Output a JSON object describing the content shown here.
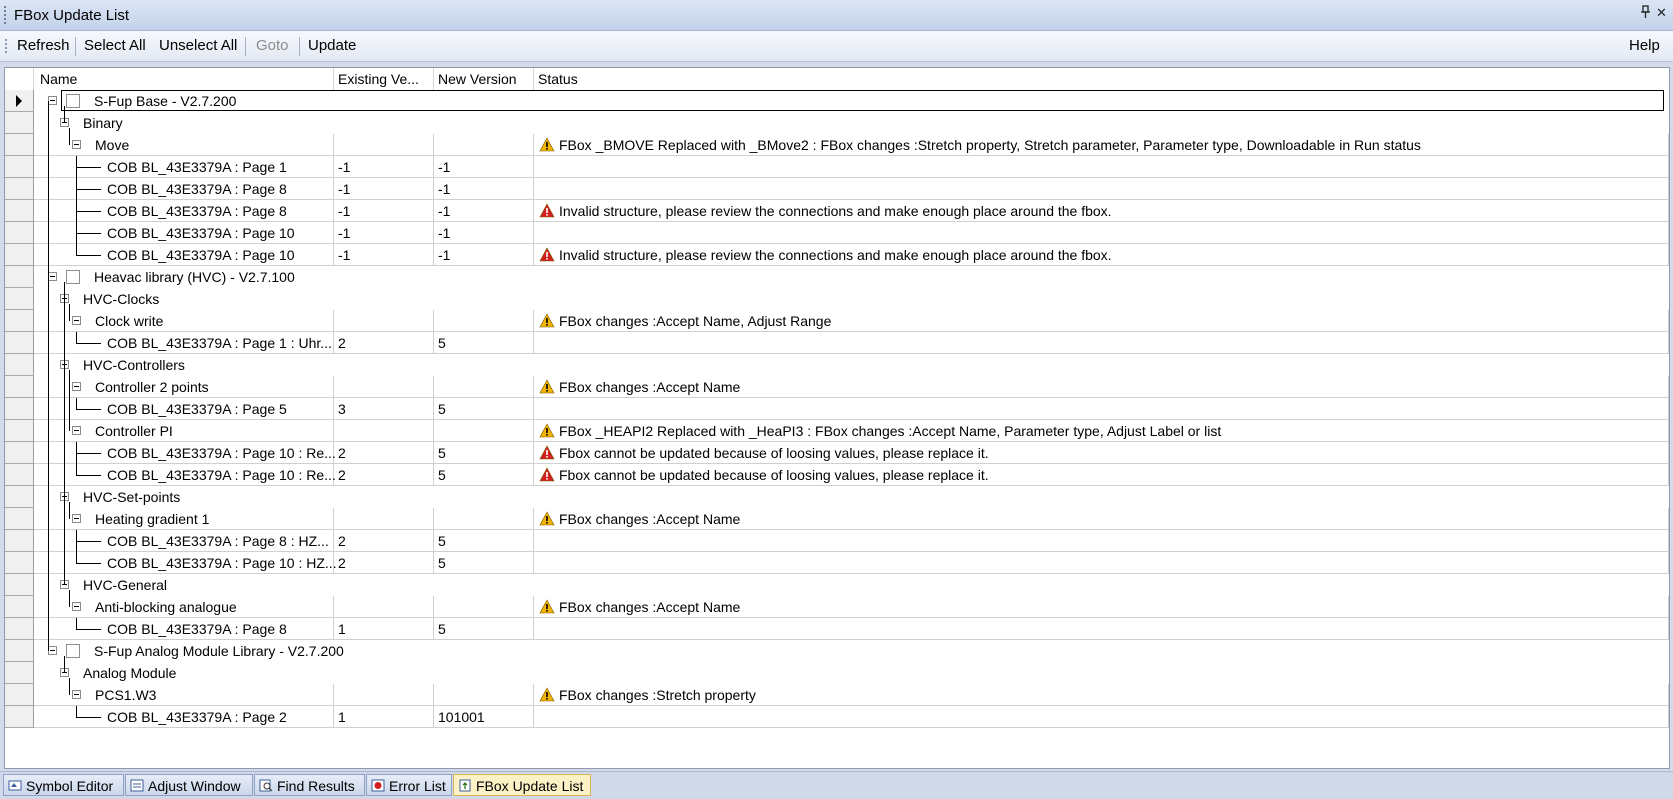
{
  "window": {
    "title": "FBox Update List",
    "pin_glyph": "ᵖ",
    "close_glyph": "✕"
  },
  "toolbar": {
    "refresh": "Refresh",
    "select_all": "Select All",
    "unselect_all": "Unselect All",
    "goto": "Goto",
    "update": "Update",
    "help": "Help"
  },
  "grid": {
    "columns": {
      "name": "Name",
      "existing": "Existing Ve...",
      "new": "New Version",
      "status": "Status"
    },
    "rows": [
      {
        "level": 0,
        "name": "S-Fup Base - V2.7.200",
        "existing": "",
        "new": "",
        "status": "",
        "icon": "",
        "checkbox": true,
        "expander": true,
        "current": true
      },
      {
        "level": 1,
        "name": "Binary",
        "existing": "",
        "new": "",
        "status": "",
        "icon": "",
        "expander": true
      },
      {
        "level": 2,
        "name": "Move",
        "existing": "",
        "new": "",
        "status": "FBox _BMOVE Replaced with _BMove2 : FBox changes :Stretch property, Stretch parameter, Parameter type, Downloadable in Run status",
        "icon": "warning",
        "expander": true,
        "cells": true
      },
      {
        "level": 3,
        "name": "COB BL_43E3379A : Page 1",
        "existing": "-1",
        "new": "-1",
        "status": "",
        "icon": "",
        "cells": true
      },
      {
        "level": 3,
        "name": "COB BL_43E3379A : Page 8",
        "existing": "-1",
        "new": "-1",
        "status": "",
        "icon": "",
        "cells": true
      },
      {
        "level": 3,
        "name": "COB BL_43E3379A : Page 8",
        "existing": "-1",
        "new": "-1",
        "status": "Invalid structure, please review the connections and make enough place around the fbox.",
        "icon": "error",
        "cells": true
      },
      {
        "level": 3,
        "name": "COB BL_43E3379A : Page 10",
        "existing": "-1",
        "new": "-1",
        "status": "",
        "icon": "",
        "cells": true
      },
      {
        "level": 3,
        "name": "COB BL_43E3379A : Page 10",
        "existing": "-1",
        "new": "-1",
        "status": "Invalid structure, please review the connections and make enough place around the fbox.",
        "icon": "error",
        "cells": true,
        "last": true
      },
      {
        "level": 0,
        "name": "Heavac library (HVC) - V2.7.100",
        "existing": "",
        "new": "",
        "status": "",
        "icon": "",
        "checkbox": true,
        "expander": true
      },
      {
        "level": 1,
        "name": "HVC-Clocks",
        "existing": "",
        "new": "",
        "status": "",
        "icon": "",
        "expander": true
      },
      {
        "level": 2,
        "name": "Clock write",
        "existing": "",
        "new": "",
        "status": "FBox changes :Accept Name, Adjust Range",
        "icon": "warning",
        "expander": true,
        "cells": true
      },
      {
        "level": 3,
        "name": "COB BL_43E3379A : Page 1 : Uhr...",
        "existing": "2",
        "new": "5",
        "status": "",
        "icon": "",
        "cells": true,
        "last": true
      },
      {
        "level": 1,
        "name": "HVC-Controllers",
        "existing": "",
        "new": "",
        "status": "",
        "icon": "",
        "expander": true
      },
      {
        "level": 2,
        "name": "Controller 2 points",
        "existing": "",
        "new": "",
        "status": "FBox changes :Accept Name",
        "icon": "warning",
        "expander": true,
        "cells": true
      },
      {
        "level": 3,
        "name": "COB BL_43E3379A : Page 5",
        "existing": "3",
        "new": "5",
        "status": "",
        "icon": "",
        "cells": true,
        "last": true
      },
      {
        "level": 2,
        "name": "Controller PI",
        "existing": "",
        "new": "",
        "status": "FBox _HEAPI2 Replaced with _HeaPI3 : FBox changes :Accept Name, Parameter type, Adjust Label or list",
        "icon": "warning",
        "expander": true,
        "cells": true
      },
      {
        "level": 3,
        "name": "COB BL_43E3379A : Page 10 : Re...",
        "existing": "2",
        "new": "5",
        "status": "Fbox cannot be updated because of loosing values, please replace it.",
        "icon": "error",
        "cells": true
      },
      {
        "level": 3,
        "name": "COB BL_43E3379A : Page 10 : Re...",
        "existing": "2",
        "new": "5",
        "status": "Fbox cannot be updated because of loosing values, please replace it.",
        "icon": "error",
        "cells": true,
        "last": true
      },
      {
        "level": 1,
        "name": "HVC-Set-points",
        "existing": "",
        "new": "",
        "status": "",
        "icon": "",
        "expander": true
      },
      {
        "level": 2,
        "name": "Heating gradient 1",
        "existing": "",
        "new": "",
        "status": "FBox changes :Accept Name",
        "icon": "warning",
        "expander": true,
        "cells": true
      },
      {
        "level": 3,
        "name": "COB BL_43E3379A : Page 8 : HZ...",
        "existing": "2",
        "new": "5",
        "status": "",
        "icon": "",
        "cells": true
      },
      {
        "level": 3,
        "name": "COB BL_43E3379A : Page 10 : HZ...",
        "existing": "2",
        "new": "5",
        "status": "",
        "icon": "",
        "cells": true,
        "last": true
      },
      {
        "level": 1,
        "name": "HVC-General",
        "existing": "",
        "new": "",
        "status": "",
        "icon": "",
        "expander": true
      },
      {
        "level": 2,
        "name": "Anti-blocking analogue",
        "existing": "",
        "new": "",
        "status": "FBox changes :Accept Name",
        "icon": "warning",
        "expander": true,
        "cells": true
      },
      {
        "level": 3,
        "name": "COB BL_43E3379A : Page 8",
        "existing": "1",
        "new": "5",
        "status": "",
        "icon": "",
        "cells": true,
        "last": true
      },
      {
        "level": 0,
        "name": "S-Fup Analog Module Library - V2.7.200",
        "existing": "",
        "new": "",
        "status": "",
        "icon": "",
        "checkbox": true,
        "expander": true
      },
      {
        "level": 1,
        "name": "Analog Module",
        "existing": "",
        "new": "",
        "status": "",
        "icon": "",
        "expander": true
      },
      {
        "level": 2,
        "name": "PCS1.W3",
        "existing": "",
        "new": "",
        "status": "FBox changes :Stretch property",
        "icon": "warning",
        "expander": true,
        "cells": true
      },
      {
        "level": 3,
        "name": "COB BL_43E3379A : Page 2",
        "existing": "1",
        "new": "101001",
        "status": "",
        "icon": "",
        "cells": true,
        "last": true
      }
    ]
  },
  "tabs": [
    {
      "label": "Symbol Editor",
      "icon": "symbol-editor-icon",
      "active": false
    },
    {
      "label": "Adjust Window",
      "icon": "adjust-window-icon",
      "active": false
    },
    {
      "label": "Find Results",
      "icon": "find-results-icon",
      "active": false
    },
    {
      "label": "Error List",
      "icon": "error-list-icon",
      "active": false
    },
    {
      "label": "FBox Update List",
      "icon": "fbox-update-list-icon",
      "active": true
    }
  ],
  "colors": {
    "warning": "#f2b400",
    "error": "#d21f1f",
    "active_tab": "#fdf2c6"
  }
}
